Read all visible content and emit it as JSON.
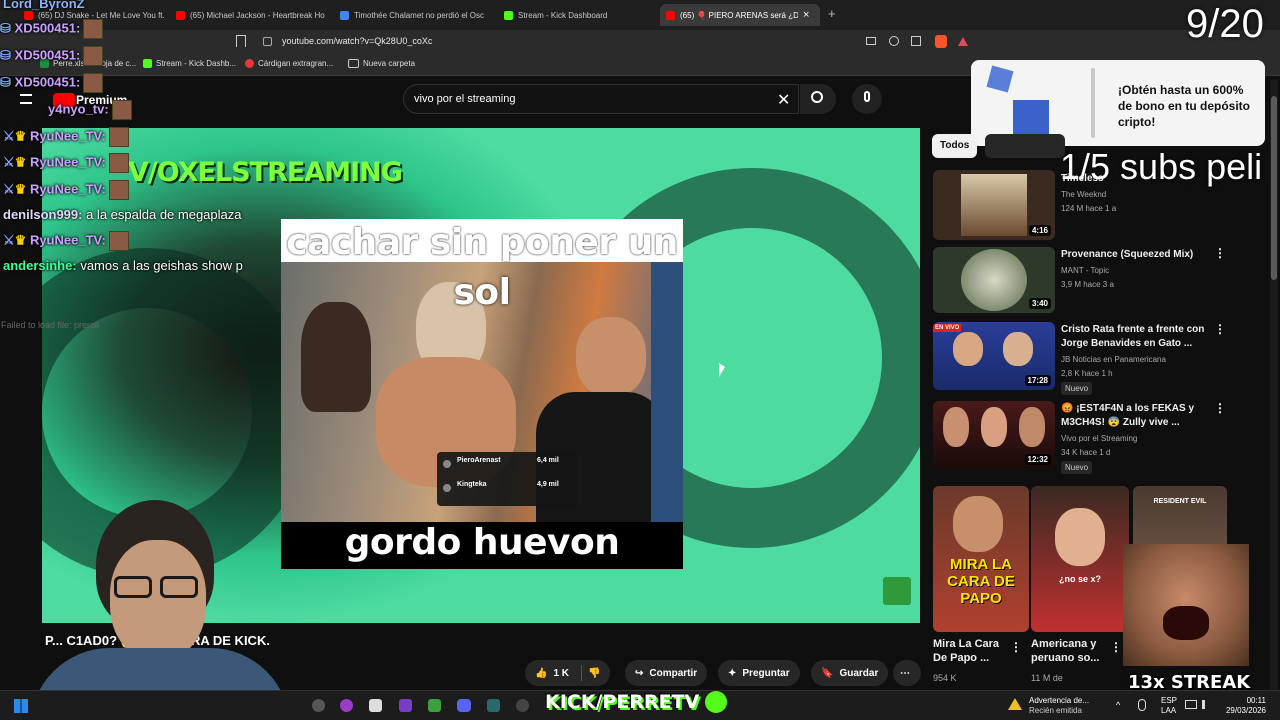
{
  "browser": {
    "tabs": [
      {
        "label": "(65) DJ Snake - Let Me Love You ft. Ju",
        "color": "#ff0000"
      },
      {
        "label": "(65) Michael Jackson - Heartbreak Ho",
        "color": "#ff0000"
      },
      {
        "label": "Timothée Chalamet no perdió el Osc",
        "color": "#4285f4"
      },
      {
        "label": "Stream - Kick Dashboard",
        "color": "#53fc18"
      },
      {
        "label": "(65) 🎈 PIERO ARENAS será ¿DE",
        "color": "#ff0000"
      }
    ],
    "tab_close": "×",
    "new_tab": "+",
    "url": "youtube.com/watch?v=Qk28U0_coXc",
    "bookmarks": [
      {
        "label": "Perre.xlsx - Hoja de c...",
        "color": "#1e8e3e"
      },
      {
        "label": "Stream - Kick Dashb...",
        "color": "#53fc18"
      },
      {
        "label": "Cárdigan extragran...",
        "color": "#e53935"
      },
      {
        "label": "Nueva carpeta",
        "color": "#cccccc"
      }
    ]
  },
  "youtube": {
    "logo_text": "Premium",
    "search_value": "vivo por el streaming",
    "video_title": "P... C1AD0? 😱 SE RETIRA DE KICK.",
    "actions": {
      "likes": "1 K",
      "share": "Compartir",
      "ask": "Preguntar",
      "save": "Guardar"
    },
    "filter_chip": "Todos"
  },
  "meme": {
    "top_text_1": "cachar sin poner un",
    "top_text_2": "sol",
    "bottom_text": "gordo huevon",
    "card": [
      {
        "name": "PieroArenast",
        "viewers": "6,4 mil"
      },
      {
        "name": "Kingteka",
        "viewers": "4,9 mil"
      }
    ]
  },
  "stream_overlay": {
    "counter": "9/20",
    "subs_goal": "1/5 subs peli",
    "brand": "V/OXELSTREAMING",
    "kick_handle": "KICK/PERRETV",
    "streak": "13x STREAK",
    "preroll_error": "Failed to load file: preroll",
    "promo_text": "¡Obtén hasta un 600% de bono en tu depósito cripto!"
  },
  "chat": [
    {
      "user": "Lord_ByronZ",
      "text": "",
      "color": "#8ab4ff"
    },
    {
      "user": "XD500451:",
      "text": "",
      "color": "#c9a2ff"
    },
    {
      "user": "XD500451:",
      "text": "",
      "color": "#c9a2ff"
    },
    {
      "user": "XD500451:",
      "text": "",
      "color": "#c9a2ff"
    },
    {
      "user": "y4nyo_tv:",
      "text": "",
      "color": "#c9a2ff"
    },
    {
      "user": "RyuNee_TV:",
      "text": "",
      "color": "#c9a2ff"
    },
    {
      "user": "RyuNee_TV:",
      "text": "",
      "color": "#c9a2ff"
    },
    {
      "user": "RyuNee_TV:",
      "text": "",
      "color": "#c9a2ff"
    },
    {
      "user": "denilson999:",
      "text": "a la espalda de megaplaza",
      "color": "#e3d9ff"
    },
    {
      "user": "RyuNee_TV:",
      "text": "",
      "color": "#c9a2ff"
    },
    {
      "user": "andersinhe:",
      "text": "vamos a las geishas show p",
      "color": "#3dff9a"
    }
  ],
  "sidebar": {
    "videos": [
      {
        "title": "Timeless",
        "channel": "The Weeknd",
        "meta": "124 M  hace 1 a",
        "duration": "4:16",
        "badge": "",
        "thumb": "#3a2a20"
      },
      {
        "title": "Provenance (Squeezed Mix)",
        "channel": "MANT - Topic",
        "meta": "3,9 M  hace 3 a",
        "duration": "3:40",
        "badge": "",
        "thumb": "#2d3a2a"
      },
      {
        "title": "Cristo Rata frente a frente con Jorge Benavides en Gato ...",
        "channel": "JB Noticias en Panamericana",
        "meta": "2,8 K  hace 1 h",
        "duration": "17:28",
        "badge": "Nuevo",
        "thumb": "#1d3e9a"
      },
      {
        "title": "😡 ¡EST4F4N a los FEKAS y M3CH4S! 😨 Zully vive ...",
        "channel": "Vivo por el Streaming",
        "meta": "34 K  hace 1 d",
        "duration": "12:32",
        "badge": "Nuevo",
        "thumb": "#3a1a1a"
      }
    ],
    "shorts": [
      {
        "title": "Mira La Cara De Papo ...",
        "meta": "954 K",
        "overlay": "MIRA LA CARA DE PAPO"
      },
      {
        "title": "Americana y peruano so...",
        "meta": "11 M de",
        "overlay": "¿no se x?"
      },
      {
        "title": "",
        "meta": "",
        "overlay": "RESIDENT EVIL"
      }
    ]
  },
  "taskbar": {
    "notification_title": "Advertencia de...",
    "notification_sub": "Recién emitida",
    "lang_1": "ESP",
    "lang_2": "LAA",
    "time": "00:11",
    "date": "29/03/2026"
  }
}
